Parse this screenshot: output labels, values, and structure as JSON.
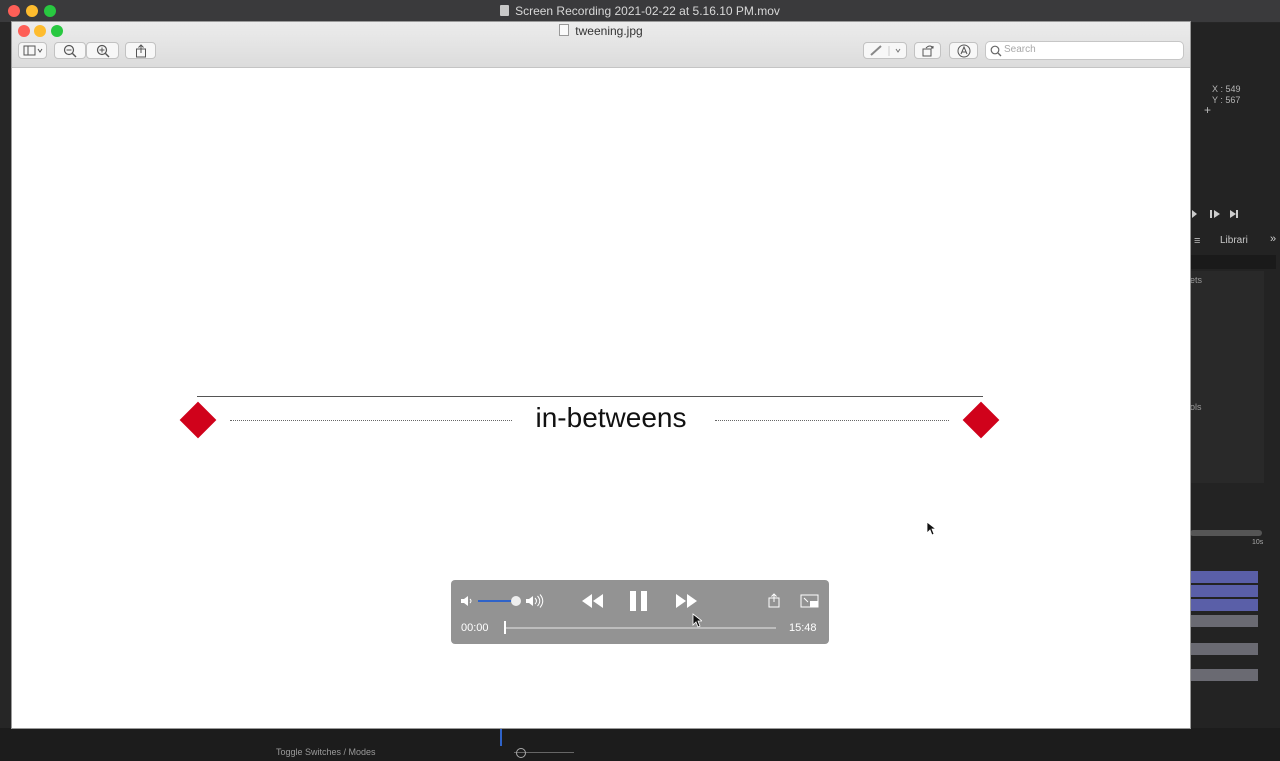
{
  "outer_window": {
    "title": "Screen Recording 2021-02-22 at 5.16.10 PM.mov"
  },
  "preview_window": {
    "title": "tweening.jpg"
  },
  "toolbar": {
    "search_placeholder": "Search",
    "icons": [
      "sidebar-toggle-icon",
      "zoom-out-icon",
      "zoom-in-icon",
      "share-icon",
      "markup-pen-icon",
      "rotate-icon",
      "annotate-icon",
      "search-icon"
    ]
  },
  "image": {
    "label": "in-betweens",
    "keyframe_color": "#d0021b"
  },
  "player": {
    "current_time": "00:00",
    "duration": "15:48",
    "volume_level": 0.85,
    "playback_progress": 0.0
  },
  "background_app": {
    "coord_x": "X : 549",
    "coord_y": "Y : 567",
    "panel_tab": "Librari",
    "panel_item_1": "ets",
    "panel_item_2": "ols",
    "timeline_label": "10s",
    "bottom_label": "Toggle Switches / Modes"
  },
  "colors": {
    "accent": "#2f63c9",
    "keyframe": "#d0021b"
  }
}
